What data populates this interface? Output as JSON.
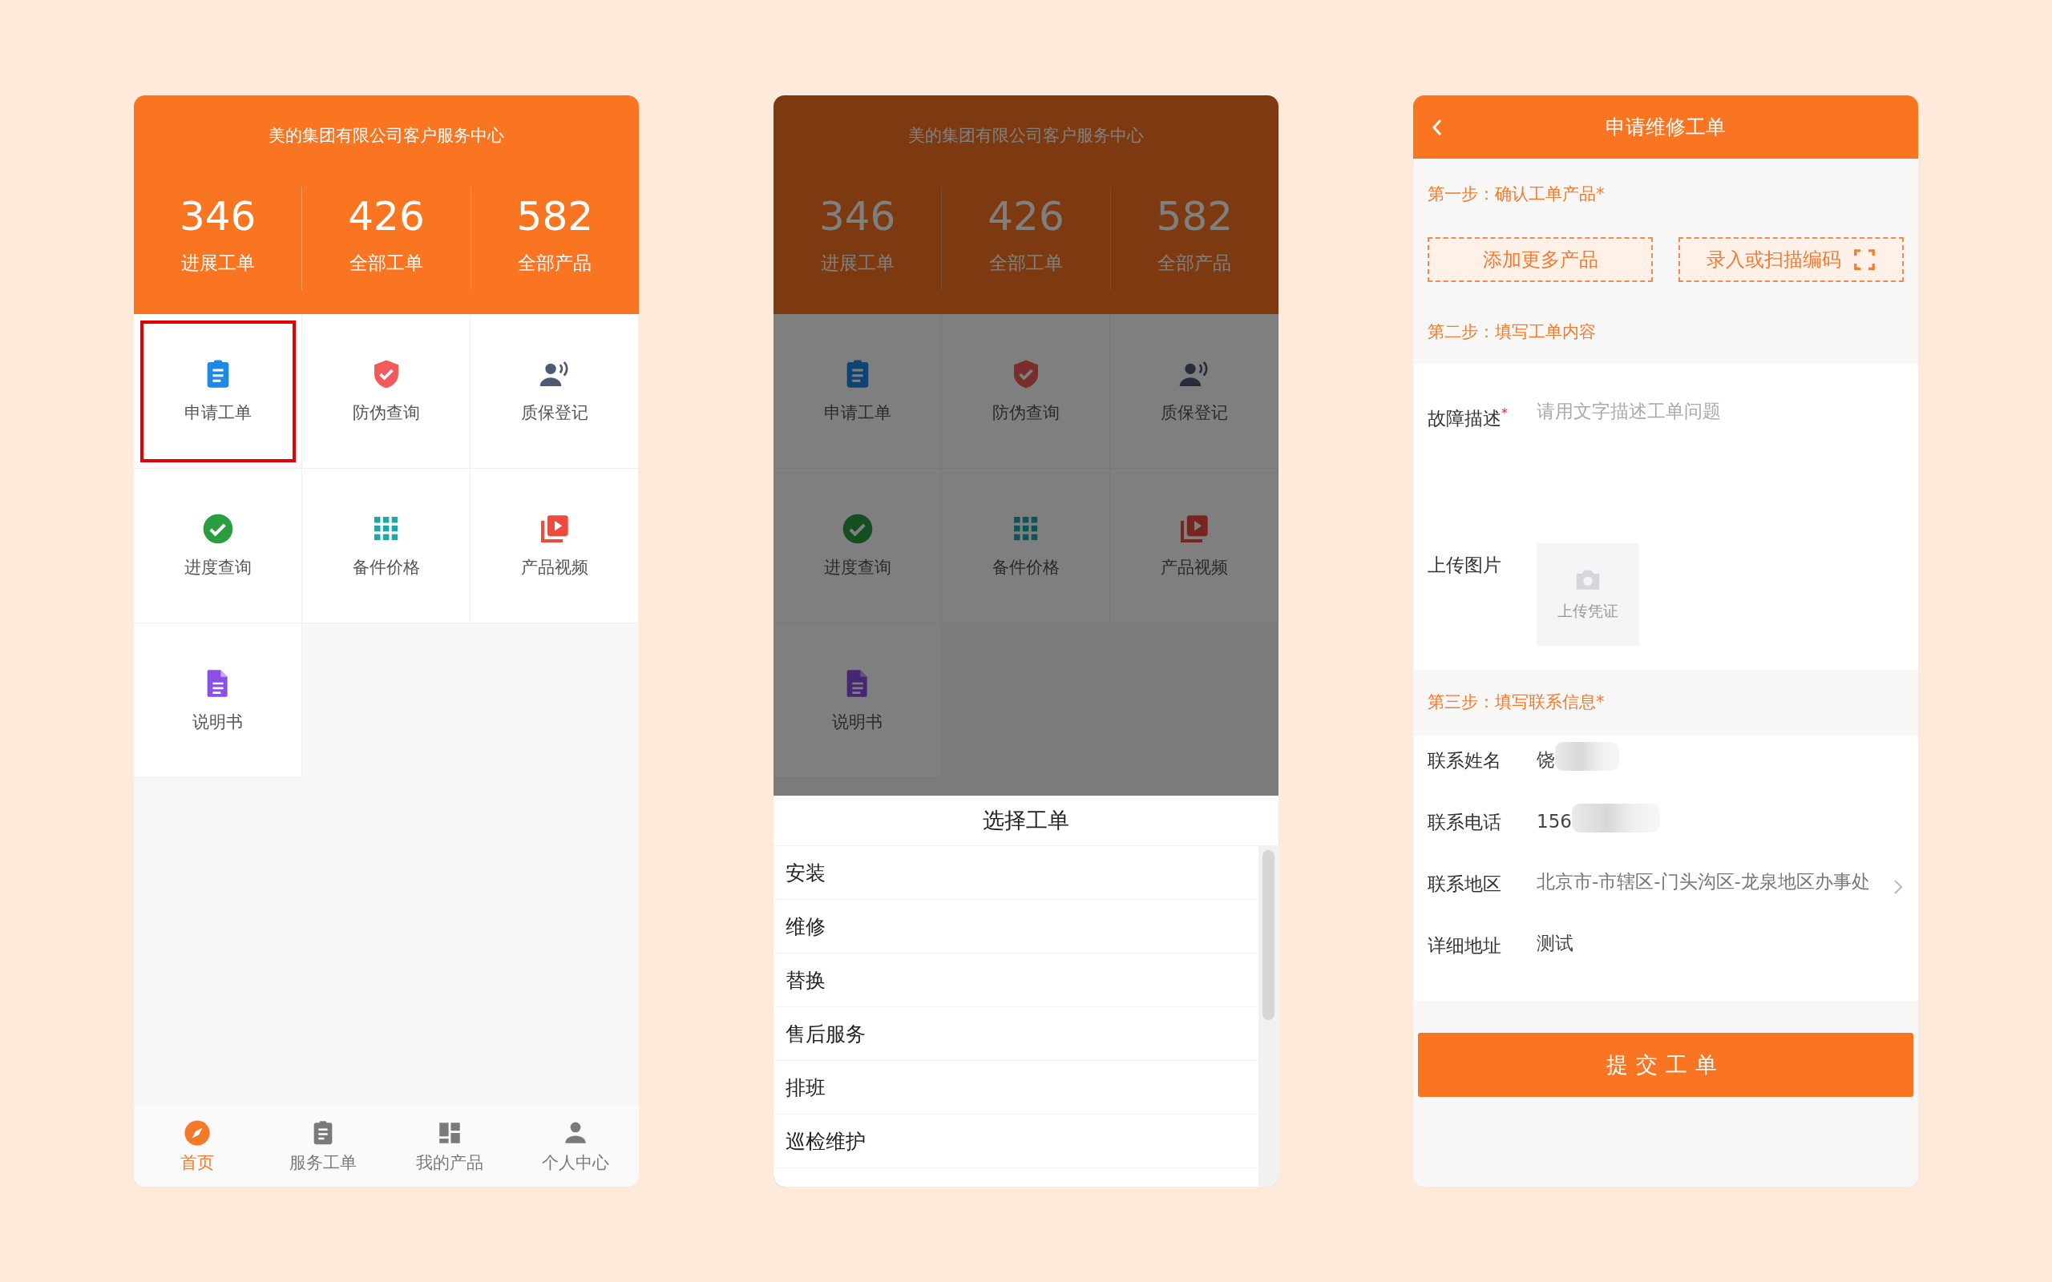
{
  "home_screen": {
    "header": {
      "title": "美的集团有限公司客户服务中心"
    },
    "stats": [
      {
        "value": "346",
        "label": "进展工单"
      },
      {
        "value": "426",
        "label": "全部工单"
      },
      {
        "value": "582",
        "label": "全部产品"
      }
    ],
    "menu": [
      {
        "label": "申请工单",
        "highlighted": true
      },
      {
        "label": "防伪查询",
        "highlighted": false
      },
      {
        "label": "质保登记",
        "highlighted": false
      },
      {
        "label": "进度查询",
        "highlighted": false
      },
      {
        "label": "备件价格",
        "highlighted": false
      },
      {
        "label": "产品视频",
        "highlighted": false
      },
      {
        "label": "说明书",
        "highlighted": false
      }
    ],
    "nav": [
      {
        "label": "首页",
        "selected": true
      },
      {
        "label": "服务工单",
        "selected": false
      },
      {
        "label": "我的产品",
        "selected": false
      },
      {
        "label": "个人中心",
        "selected": false
      }
    ]
  },
  "picker_screen": {
    "header": {
      "title": "美的集团有限公司客户服务中心"
    },
    "stats": [
      {
        "value": "346",
        "label": "进展工单"
      },
      {
        "value": "426",
        "label": "全部工单"
      },
      {
        "value": "582",
        "label": "全部产品"
      }
    ],
    "menu": [
      {
        "label": "申请工单",
        "highlighted": false
      },
      {
        "label": "防伪查询",
        "highlighted": false
      },
      {
        "label": "质保登记",
        "highlighted": false
      },
      {
        "label": "进度查询",
        "highlighted": false
      },
      {
        "label": "备件价格",
        "highlighted": false
      },
      {
        "label": "产品视频",
        "highlighted": false
      },
      {
        "label": "说明书",
        "highlighted": false
      }
    ],
    "sheet": {
      "title": "选择工单",
      "options": [
        "安装",
        "维修",
        "替换",
        "售后服务",
        "排班",
        "巡检维护"
      ]
    }
  },
  "form_screen": {
    "title": "申请维修工单",
    "step1": {
      "label": "第一步：确认工单产品*",
      "buttons": [
        "添加更多产品",
        "录入或扫描编码"
      ]
    },
    "step2": {
      "label": "第二步：填写工单内容",
      "fault": {
        "label": "故障描述$^{*}$",
        "placeholder": "请用文字描述工单问题"
      },
      "upload": {
        "label": "上传图片",
        "button": "上传凭证"
      }
    },
    "step3": {
      "label": "第三步：填写联系信息*",
      "fields": [
        {
          "label": "联系姓名",
          "value": "饶",
          "kind": "text",
          "blurred": true
        },
        {
          "label": "联系电话",
          "value": "156",
          "kind": "text",
          "blurred": true
        },
        {
          "label": "联系地区",
          "value": "北京市-市辖区-门头沟区-龙泉地区办事处",
          "kind": "picker",
          "blurred": false
        },
        {
          "label": "详细地址",
          "value": "测试",
          "kind": "textarea",
          "blurred": false
        }
      ]
    },
    "submit": "提交工单"
  }
}
